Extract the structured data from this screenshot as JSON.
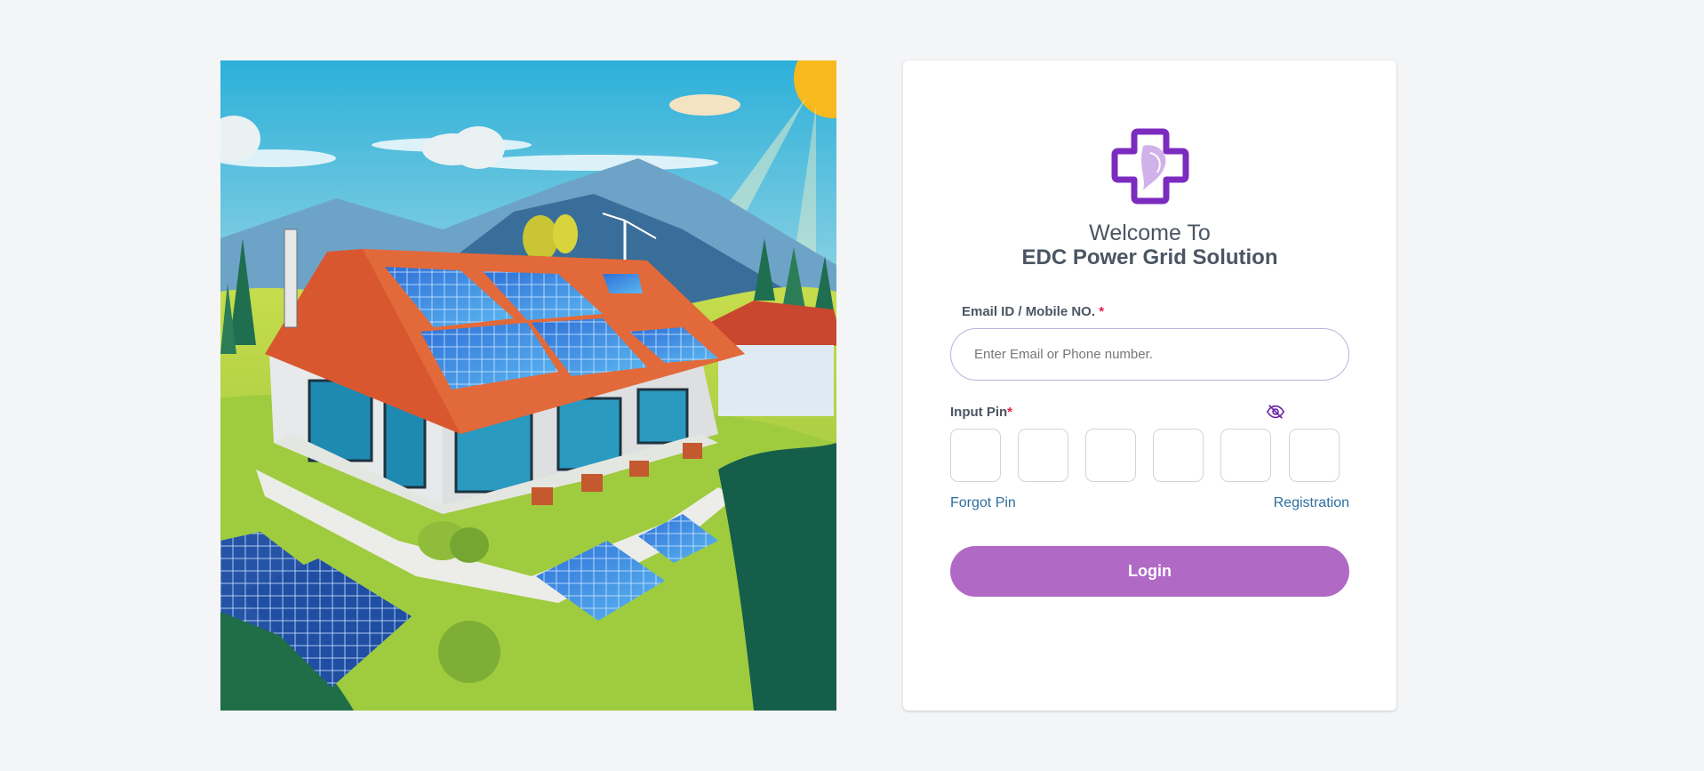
{
  "illustration": {
    "icon": "solar-house-illustration"
  },
  "login": {
    "logo_icon": "medical-cross-logo",
    "welcome_text": "Welcome To",
    "company_name": "EDC Power Grid Solution",
    "email_label": "Email ID / Mobile NO.",
    "email_required_mark": "*",
    "email_placeholder": "Enter Email or Phone number.",
    "email_value": "",
    "pin_label": "Input Pin",
    "pin_required_mark": "*",
    "pin_visibility_icon": "eye-slash-icon",
    "pin_digits": [
      "",
      "",
      "",
      "",
      "",
      ""
    ],
    "forgot_pin_label": "Forgot Pin",
    "registration_label": "Registration",
    "login_button_label": "Login"
  },
  "colors": {
    "page_background": "#f4f5f7",
    "primary_button": "#b06ac6",
    "link": "#2f6e9e",
    "required": "#e11d48",
    "logo_purple": "#7b2cbf",
    "text": "#4b5563"
  }
}
